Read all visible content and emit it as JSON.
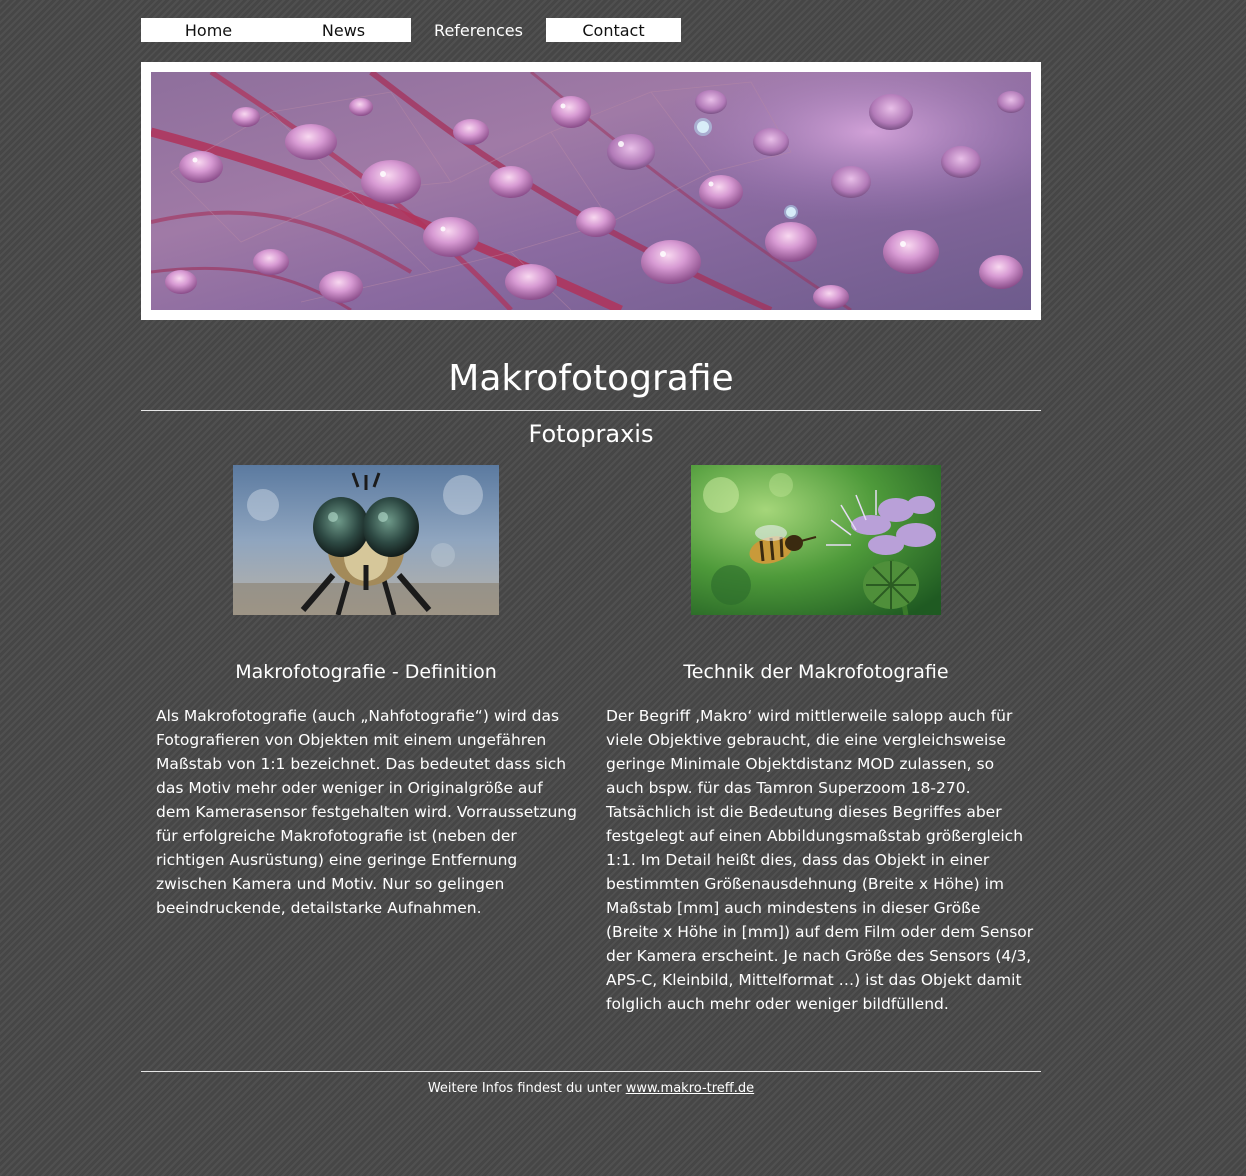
{
  "nav": {
    "items": [
      {
        "label": "Home"
      },
      {
        "label": "News"
      },
      {
        "label": "References"
      },
      {
        "label": "Contact"
      }
    ]
  },
  "banner": {
    "image": "leaf-with-water-drops-macro-photo"
  },
  "main": {
    "title": "Makrofotografie",
    "subtitle": "Fotopraxis",
    "photos": [
      {
        "image": "robber-fly-head-macro-photo"
      },
      {
        "image": "bee-on-purple-flower-photo"
      }
    ],
    "columns": [
      {
        "heading": "Makrofotografie - Definition",
        "text": "Als Makrofotografie (auch „Nahfotografie“) wird das Fotografieren von Objekten mit einem ungefähren Maßstab von 1:1 bezeichnet. Das bedeutet dass sich das Motiv mehr oder weniger in Originalgröße auf dem Kamerasensor festgehalten wird. Vorraussetzung für erfolgreiche Makrofotografie ist (neben der richtigen Ausrüstung) eine geringe Entfernung zwischen Kamera und Motiv. Nur so gelingen beeindruckende, detailstarke Aufnahmen."
      },
      {
        "heading": "Technik der Makrofotografie",
        "text": "Der Begriff ‚Makro‘ wird mittlerweile salopp auch für viele Objektive gebraucht, die eine vergleichsweise geringe Minimale Objektdistanz MOD zulassen, so auch bspw. für das Tamron Superzoom 18-270. Tatsächlich ist die Bedeutung dieses Begriffes aber festgelegt auf einen Abbildungsmaßstab größergleich 1:1. Im Detail heißt dies, dass das Objekt in einer bestimmten Größenausdehnung (Breite x Höhe) im Maßstab [mm] auch mindestens in dieser Größe (Breite x Höhe in [mm]) auf dem Film oder dem Sensor der Kamera erscheint. Je nach Größe des Sensors (4/3, APS-C, Kleinbild, Mittelformat …) ist das Objekt damit folglich auch mehr oder weniger bildfüllend."
      }
    ]
  },
  "footer": {
    "prefix": "Weitere Infos findest du unter ",
    "link_text": "www.makro-treff.de"
  },
  "colors": {
    "background": "#4a4a4a",
    "nav_active_bg": "#ffffff",
    "text": "#ffffff"
  }
}
